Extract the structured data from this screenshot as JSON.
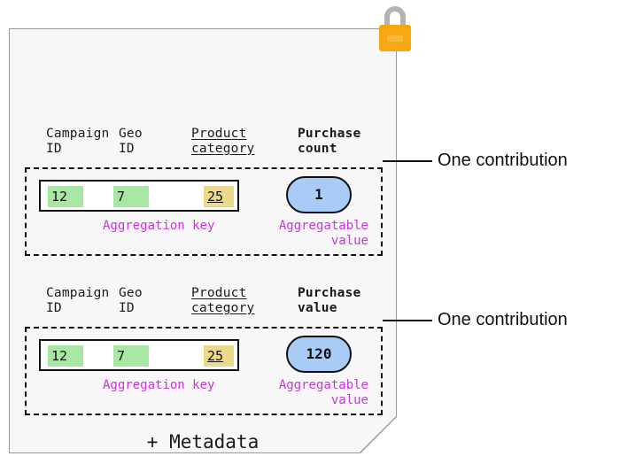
{
  "card": {
    "metadata_label": "+ Metadata"
  },
  "lock": {
    "icon": "lock-icon",
    "body_color": "#f7a711",
    "shackle_color": "#b3b3b3"
  },
  "colors": {
    "key_highlight_green": "#a8e6a3",
    "key_highlight_yellow": "#ecd98a",
    "value_oval_blue": "#a8ccf5",
    "annotation_magenta": "#cc33e0",
    "card_background": "#f7f7f7",
    "outline": "#111111"
  },
  "contributions": [
    {
      "headers": {
        "campaign_id": "Campaign\nID",
        "geo_id": "Geo\nID",
        "product_category": "Product\ncategory",
        "measure": "Purchase\ncount"
      },
      "key_cells": [
        "12",
        "7",
        "25"
      ],
      "value": "1",
      "annotations": {
        "key": "Aggregation key",
        "value": "Aggregatable\nvalue"
      },
      "callout": "One contribution"
    },
    {
      "headers": {
        "campaign_id": "Campaign\nID",
        "geo_id": "Geo\nID",
        "product_category": "Product\ncategory",
        "measure": "Purchase\nvalue"
      },
      "key_cells": [
        "12",
        "7",
        "25"
      ],
      "value": "120",
      "annotations": {
        "key": "Aggregation key",
        "value": "Aggregatable\nvalue"
      },
      "callout": "One contribution"
    }
  ]
}
